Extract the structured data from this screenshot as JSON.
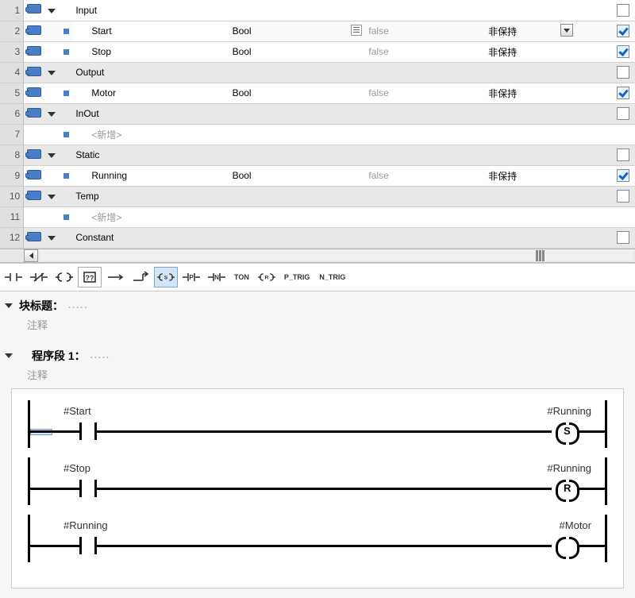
{
  "table": {
    "rows": [
      {
        "num": "1",
        "section": true,
        "name": "Input",
        "type": "",
        "default": "",
        "retain": "",
        "checked": false
      },
      {
        "num": "2",
        "name": "Start",
        "type": "Bool",
        "default": "false",
        "retain": "非保持",
        "listicon": true,
        "dd": true,
        "checked": true,
        "selected": true
      },
      {
        "num": "3",
        "name": "Stop",
        "type": "Bool",
        "default": "false",
        "retain": "非保持",
        "checked": true
      },
      {
        "num": "4",
        "section": true,
        "name": "Output",
        "type": "",
        "default": "",
        "retain": "",
        "checked": false
      },
      {
        "num": "5",
        "name": "Motor",
        "type": "Bool",
        "default": "false",
        "retain": "非保持",
        "checked": true
      },
      {
        "num": "6",
        "section": true,
        "name": "InOut",
        "type": "",
        "default": "",
        "retain": "",
        "checked": false
      },
      {
        "num": "7",
        "notag": true,
        "name": "<新增>",
        "gray": true,
        "type": "",
        "default": "",
        "retain": ""
      },
      {
        "num": "8",
        "section": true,
        "name": "Static",
        "type": "",
        "default": "",
        "retain": "",
        "checked": false
      },
      {
        "num": "9",
        "name": "Running",
        "type": "Bool",
        "default": "false",
        "retain": "非保持",
        "checked": true
      },
      {
        "num": "10",
        "section": true,
        "name": "Temp",
        "type": "",
        "default": "",
        "retain": "",
        "checked": false
      },
      {
        "num": "11",
        "notag": true,
        "name": "<新增>",
        "gray": true,
        "type": "",
        "default": "",
        "retain": ""
      },
      {
        "num": "12",
        "section": true,
        "name": "Constant",
        "type": "",
        "default": "",
        "retain": "",
        "checked": false
      }
    ]
  },
  "toolbar": {
    "items": [
      {
        "id": "contact-no",
        "svg": "no"
      },
      {
        "id": "contact-nc",
        "svg": "nc"
      },
      {
        "id": "coil",
        "svg": "coil"
      },
      {
        "id": "box-qq",
        "svg": "qq",
        "boxed": true
      },
      {
        "id": "branch-open",
        "svg": "bo"
      },
      {
        "id": "branch-close",
        "svg": "bc"
      },
      {
        "id": "coil-s",
        "svg": "s",
        "active": true
      },
      {
        "id": "contact-p",
        "svg": "p"
      },
      {
        "id": "contact-n",
        "svg": "n"
      },
      {
        "id": "ton",
        "text": "TON"
      },
      {
        "id": "coil-r",
        "svg": "r"
      },
      {
        "id": "ptrig",
        "text": "P_TRIG"
      },
      {
        "id": "ntrig",
        "text": "N_TRIG"
      }
    ]
  },
  "blockTitle": {
    "label": "块标题：",
    "dots": "....."
  },
  "blockComment": "注释",
  "network1": {
    "label": "程序段 1：",
    "dots": ".....",
    "comment": "注释"
  },
  "ladder": {
    "rungs": [
      {
        "contact": "#Start",
        "coil": "#Running",
        "coilType": "S",
        "startIndicator": true
      },
      {
        "contact": "#Stop",
        "coil": "#Running",
        "coilType": "R"
      },
      {
        "contact": "#Running",
        "coil": "#Motor",
        "coilType": ""
      }
    ]
  }
}
